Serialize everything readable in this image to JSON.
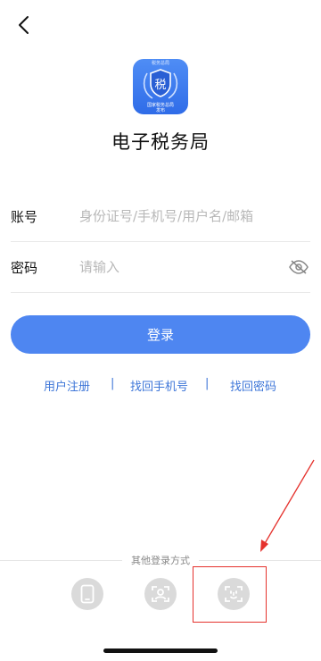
{
  "header": {
    "back_icon": "chevron-left-icon"
  },
  "logo": {
    "top_text": "税务总局",
    "bottom_text_line1": "国家税务总局",
    "bottom_text_line2": "发布",
    "glyph": "税",
    "color": "#3a78ee"
  },
  "app": {
    "title": "电子税务局"
  },
  "form": {
    "account_label": "账号",
    "account_placeholder": "身份证号/手机号/用户名/邮箱",
    "account_value": "",
    "password_label": "密码",
    "password_placeholder": "请输入",
    "password_value": "",
    "eye_icon": "eye-off-icon",
    "login_label": "登录"
  },
  "links": {
    "register": "用户注册",
    "sep1": "|",
    "recover_phone": "找回手机号",
    "sep2": "|",
    "recover_password": "找回密码"
  },
  "other_login": {
    "label": "其他登录方式",
    "methods": [
      {
        "icon": "phone-icon"
      },
      {
        "icon": "person-card-icon"
      },
      {
        "icon": "face-scan-icon"
      }
    ]
  },
  "colors": {
    "accent": "#4e86f1",
    "link": "#3e76d8",
    "annotation": "#e5322d"
  }
}
